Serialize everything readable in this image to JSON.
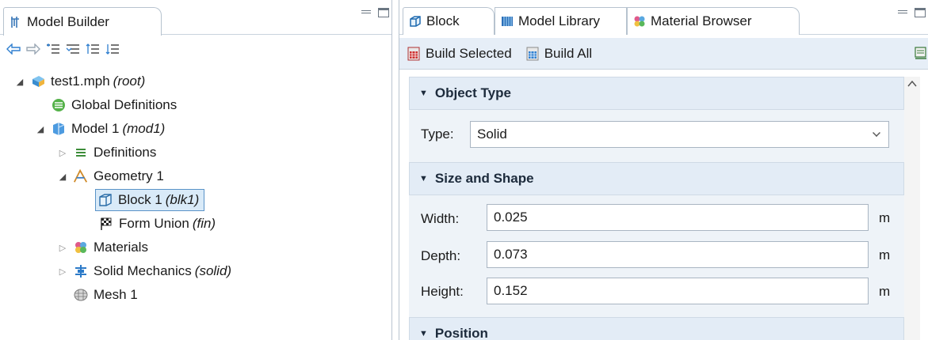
{
  "left_panel": {
    "tab_label": "Model Builder",
    "toolbar": {
      "back": "⇦",
      "forward": "⇨",
      "expand_all": "☰",
      "collapse": "☰",
      "move_up": "☰",
      "move_down": "☰"
    },
    "tree": [
      {
        "label": "test1.mph",
        "tag": "(root)",
        "level": 0,
        "expander": "open",
        "icon": "mph-file-icon"
      },
      {
        "label": "Global Definitions",
        "tag": "",
        "level": 1,
        "expander": "none",
        "icon": "global-definitions-icon"
      },
      {
        "label": "Model 1",
        "tag": "(mod1)",
        "level": 1,
        "expander": "open",
        "icon": "model-icon"
      },
      {
        "label": "Definitions",
        "tag": "",
        "level": 2,
        "expander": "closed",
        "icon": "definitions-icon"
      },
      {
        "label": "Geometry 1",
        "tag": "",
        "level": 2,
        "expander": "open",
        "icon": "geometry-icon"
      },
      {
        "label": "Block 1",
        "tag": "(blk1)",
        "level": 3,
        "expander": "none",
        "icon": "block-icon",
        "selected": true
      },
      {
        "label": "Form Union",
        "tag": "(fin)",
        "level": 3,
        "expander": "none",
        "icon": "form-union-icon"
      },
      {
        "label": "Materials",
        "tag": "",
        "level": 2,
        "expander": "closed",
        "icon": "materials-icon"
      },
      {
        "label": "Solid Mechanics",
        "tag": "(solid)",
        "level": 2,
        "expander": "closed",
        "icon": "solid-mechanics-icon"
      },
      {
        "label": "Mesh 1",
        "tag": "",
        "level": 2,
        "expander": "none",
        "icon": "mesh-icon"
      }
    ]
  },
  "right_panel": {
    "tabs": [
      {
        "label": "Block",
        "active": true,
        "icon": "block-icon"
      },
      {
        "label": "Model Library",
        "active": false,
        "icon": "model-library-icon"
      },
      {
        "label": "Material Browser",
        "active": false,
        "icon": "material-browser-icon"
      }
    ],
    "build_bar": {
      "build_selected": "Build Selected",
      "build_all": "Build All"
    },
    "sections": {
      "object_type": {
        "title": "Object Type",
        "type_label": "Type:",
        "type_value": "Solid"
      },
      "size_and_shape": {
        "title": "Size and Shape",
        "width_label": "Width:",
        "width_value": "0.025",
        "depth_label": "Depth:",
        "depth_value": "0.073",
        "height_label": "Height:",
        "height_value": "0.152",
        "unit": "m"
      },
      "position": {
        "title": "Position"
      }
    }
  },
  "colors": {
    "accent_blue": "#2f7fd0",
    "selection_bg": "#d9eaf8",
    "section_bg": "#e3ecf6",
    "panel_bg": "#eef3f8"
  }
}
